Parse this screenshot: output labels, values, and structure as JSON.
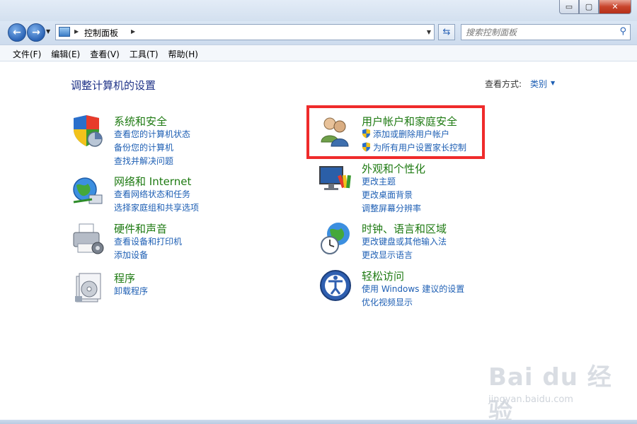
{
  "window": {
    "controls": {
      "minimize": "▭",
      "maximize": "▢",
      "close": "✕"
    }
  },
  "address_bar": {
    "breadcrumb": "控制面板",
    "search_placeholder": "搜索控制面板"
  },
  "menu": [
    "文件(F)",
    "编辑(E)",
    "查看(V)",
    "工具(T)",
    "帮助(H)"
  ],
  "content": {
    "heading": "调整计算机的设置",
    "view_by_label": "查看方式:",
    "view_by_value": "类别"
  },
  "categories": [
    {
      "icon": "shield-computer-icon",
      "title": "系统和安全",
      "links": [
        "查看您的计算机状态",
        "备份您的计算机",
        "查找并解决问题"
      ]
    },
    {
      "icon": "network-globe-icon",
      "title": "网络和 Internet",
      "links": [
        "查看网络状态和任务",
        "选择家庭组和共享选项"
      ]
    },
    {
      "icon": "printer-icon",
      "title": "硬件和声音",
      "links": [
        "查看设备和打印机",
        "添加设备"
      ]
    },
    {
      "icon": "programs-icon",
      "title": "程序",
      "links": [
        "卸载程序"
      ]
    },
    {
      "icon": "users-icon",
      "title": "用户帐户和家庭安全",
      "links": [
        "添加或删除用户帐户",
        "为所有用户设置家长控制"
      ],
      "highlighted": true
    },
    {
      "icon": "monitor-palette-icon",
      "title": "外观和个性化",
      "links": [
        "更改主题",
        "更改桌面背景",
        "调整屏幕分辨率"
      ]
    },
    {
      "icon": "clock-globe-icon",
      "title": "时钟、语言和区域",
      "links": [
        "更改键盘或其他输入法",
        "更改显示语言"
      ]
    },
    {
      "icon": "ease-of-access-icon",
      "title": "轻松访问",
      "links": [
        "使用 Windows 建议的设置",
        "优化视频显示"
      ]
    }
  ],
  "watermark": {
    "brand": "Bai du 经验",
    "url": "jingyan.baidu.com"
  },
  "colors": {
    "category_title": "#1e7a12",
    "link": "#1e5fb4",
    "heading": "#1e3287",
    "highlight": "#ef2b2b"
  }
}
